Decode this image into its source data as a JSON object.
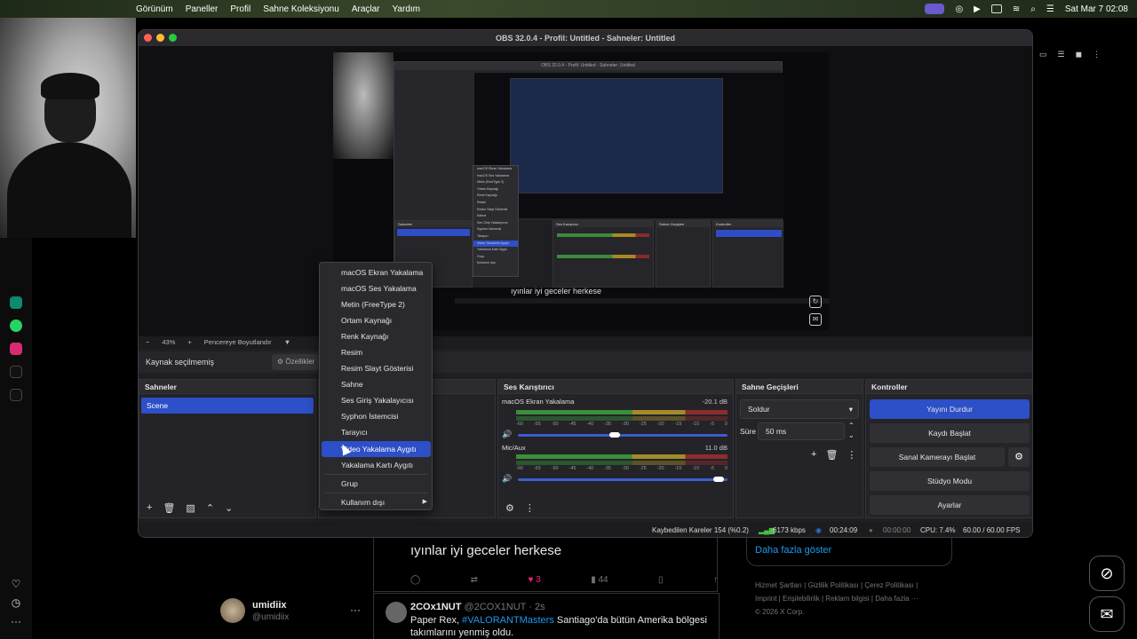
{
  "menubar": {
    "items": [
      "Görünüm",
      "Paneller",
      "Profil",
      "Sahne Koleksiyonu",
      "Araçlar",
      "Yardım"
    ],
    "clock": "Sat Mar 7  02:08"
  },
  "obs": {
    "title": "OBS 32.0.4 - Profil: Untitled - Sahneler: Untitled",
    "zoom": "43%",
    "resize_label": "Pencereye Boyutlandır",
    "no_source": "Kaynak seçilmemiş",
    "properties_label": "Özellikler",
    "preview_caption": "ıyınlar iyi geceler herkese",
    "scenes": {
      "title": "Sahneler",
      "items": [
        "Scene"
      ]
    },
    "mixer": {
      "title": "Ses Karıştırıcı",
      "channels": [
        {
          "name": "macOS Ekran Yakalama",
          "db": "-20.1 dB",
          "volume": 0.46
        },
        {
          "name": "Mic/Aux",
          "db": "11.0 dB",
          "volume": 0.98
        }
      ],
      "scale": [
        "-60",
        "-55",
        "-50",
        "-45",
        "-40",
        "-35",
        "-30",
        "-25",
        "-20",
        "-15",
        "-10",
        "-5",
        "0"
      ]
    },
    "transitions": {
      "title": "Sahne Geçişleri",
      "selected": "Soldur",
      "duration_label": "Süre",
      "duration": "50 ms"
    },
    "controls": {
      "title": "Kontroller",
      "stop_stream": "Yayını Durdur",
      "start_record": "Kaydı Başlat",
      "start_virtualcam": "Sanal Kamerayı Başlat",
      "studio_mode": "Stüdyo Modu",
      "settings": "Ayarlar"
    },
    "status": {
      "dropped": "Kaybedilen Kareler 154 (%0.2)",
      "bitrate": "6173 kbps",
      "stream_time": "00:24:09",
      "record_time": "00:00:00",
      "cpu": "CPU: 7.4%",
      "fps": "60.00 / 60.00 FPS"
    }
  },
  "context_menu": {
    "items": [
      "macOS Ekran Yakalama",
      "macOS Ses Yakalama",
      "Metin (FreeType 2)",
      "Ortam Kaynağı",
      "Renk Kaynağı",
      "Resim",
      "Resim Slayt Gösterisi",
      "Sahne",
      "Ses Giriş Yakalayıcısı",
      "Syphon İstemcisi",
      "Tarayıcı",
      "Video Yakalama Aygıtı",
      "Yakalama Kartı Aygıtı"
    ],
    "group": "Grup",
    "deprecated": "Kullanım dışı",
    "highlighted_index": 11
  },
  "browser": {
    "tweet_text": "ıyınlar iyi geceler herkese",
    "likes": "3",
    "views": "44",
    "user_name": "umidiix",
    "user_handle": "@umidiix",
    "tweet2_name": "2COx1NUT",
    "tweet2_handle": "@2COX1NUT · 2s",
    "tweet2_body_a": "Paper Rex, ",
    "tweet2_link": "#VALORANTMasters",
    "tweet2_body_b": " Santiago'da bütün Amerika bölgesi takımlarını yenmiş oldu.",
    "show_more": "Daha fazla göster",
    "footer": [
      "Hizmet Şartları",
      "Gizlilik Politikası",
      "Çerez Politikası",
      "Imprint",
      "Erişilebilirlik",
      "Reklam bilgisi",
      "Daha fazla ···",
      "© 2026 X Corp."
    ]
  },
  "colors": {
    "accent": "#2d4fc7",
    "obs_bg": "#1f1f23"
  }
}
